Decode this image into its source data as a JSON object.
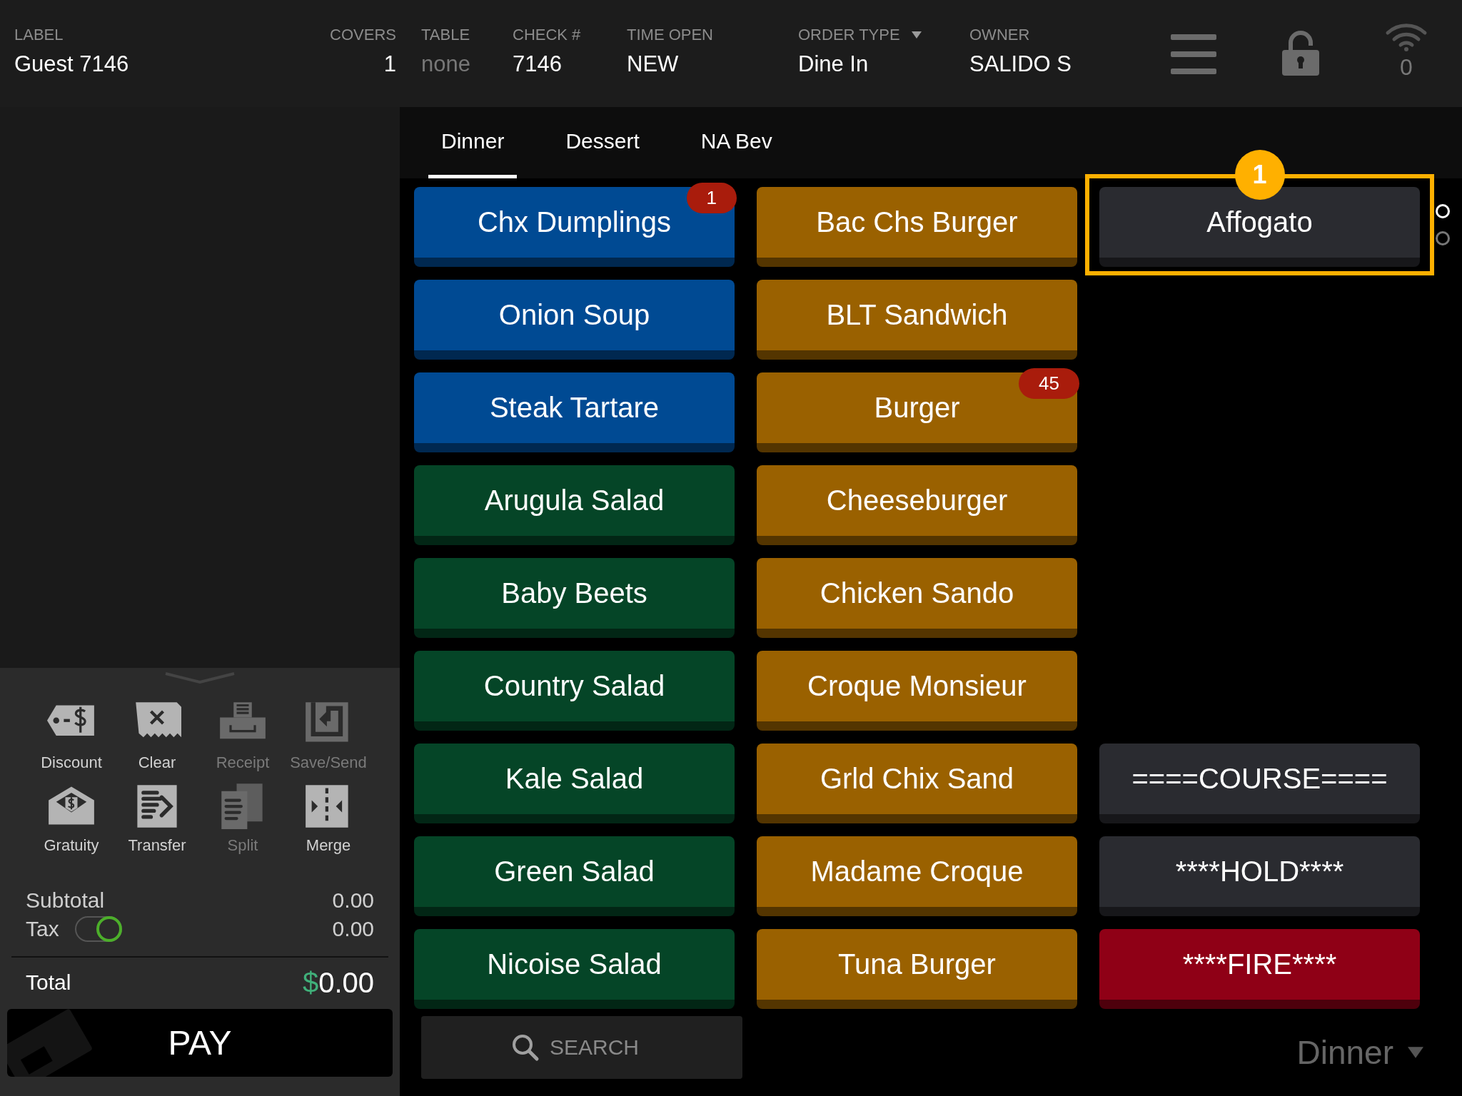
{
  "header": {
    "fields": [
      {
        "label": "LABEL",
        "value": "Guest 7146",
        "muted": false,
        "dropdown": false
      },
      {
        "label": "COVERS",
        "value": "1",
        "muted": false,
        "dropdown": false
      },
      {
        "label": "TABLE",
        "value": "none",
        "muted": true,
        "dropdown": false
      },
      {
        "label": "CHECK #",
        "value": "7146",
        "muted": false,
        "dropdown": false
      },
      {
        "label": "TIME OPEN",
        "value": "NEW",
        "muted": false,
        "dropdown": false
      },
      {
        "label": "ORDER TYPE",
        "value": "Dine In",
        "muted": false,
        "dropdown": true
      },
      {
        "label": "OWNER",
        "value": "SALIDO S",
        "muted": false,
        "dropdown": false
      }
    ],
    "wifi_count": "0"
  },
  "check_panel": {
    "actions": [
      {
        "label": "Discount",
        "enabled": true
      },
      {
        "label": "Clear",
        "enabled": true
      },
      {
        "label": "Receipt",
        "enabled": false
      },
      {
        "label": "Save/Send",
        "enabled": false
      },
      {
        "label": "Gratuity",
        "enabled": true
      },
      {
        "label": "Transfer",
        "enabled": true
      },
      {
        "label": "Split",
        "enabled": false
      },
      {
        "label": "Merge",
        "enabled": true
      }
    ],
    "subtotal": {
      "label": "Subtotal",
      "value": "0.00"
    },
    "tax": {
      "label": "Tax",
      "value": "0.00",
      "on": true
    },
    "total": {
      "label": "Total",
      "currency": "$",
      "amount": "0.00"
    },
    "pay_button": "PAY"
  },
  "menu": {
    "tabs": [
      {
        "label": "Dinner",
        "selected": true
      },
      {
        "label": "Dessert",
        "selected": false
      },
      {
        "label": "NA Bev",
        "selected": false
      }
    ],
    "columns": [
      {
        "items": [
          {
            "label": "Chx Dumplings",
            "color": "#004a93",
            "badge": "1"
          },
          {
            "label": "Onion Soup",
            "color": "#004a93"
          },
          {
            "label": "Steak Tartare",
            "color": "#004a93"
          },
          {
            "label": "Arugula Salad",
            "color": "#054527"
          },
          {
            "label": "Baby Beets",
            "color": "#054527"
          },
          {
            "label": "Country Salad",
            "color": "#054527"
          },
          {
            "label": "Kale Salad",
            "color": "#054527"
          },
          {
            "label": "Green Salad",
            "color": "#054527"
          },
          {
            "label": "Nicoise Salad",
            "color": "#054527"
          }
        ]
      },
      {
        "items": [
          {
            "label": "Bac Chs Burger",
            "color": "#9a6100"
          },
          {
            "label": "BLT Sandwich",
            "color": "#9a6100"
          },
          {
            "label": "Burger",
            "color": "#9a6100",
            "badge": "45"
          },
          {
            "label": "Cheeseburger",
            "color": "#9a6100"
          },
          {
            "label": "Chicken Sando",
            "color": "#9a6100"
          },
          {
            "label": "Croque Monsieur",
            "color": "#9a6100"
          },
          {
            "label": "Grld Chix Sand",
            "color": "#9a6100"
          },
          {
            "label": "Madame Croque",
            "color": "#9a6100"
          },
          {
            "label": "Tuna Burger",
            "color": "#9a6100"
          }
        ]
      },
      {
        "items": [
          {
            "label": "Affogato",
            "color": "#2a2b30",
            "callout": "1"
          }
        ],
        "bottom_items": [
          {
            "label": "====COURSE====",
            "color": "#2a2b30"
          },
          {
            "label": "****HOLD****",
            "color": "#2a2b30"
          },
          {
            "label": "****FIRE****",
            "color": "#8f0016"
          }
        ]
      }
    ],
    "page_dots": [
      {
        "selected": true
      },
      {
        "selected": false
      }
    ],
    "search": {
      "placeholder": "SEARCH"
    },
    "menu_selector": "Dinner"
  }
}
